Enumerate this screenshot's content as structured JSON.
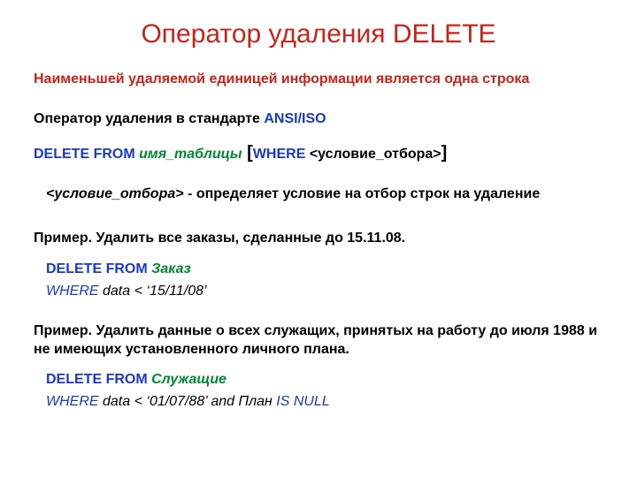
{
  "title": "Оператор удаления DELETE",
  "intro": "Наименьшей удаляемой единицей информации является одна строка",
  "std_label_prefix": "Оператор удаления в стандарте ",
  "std_label_ansi": "ANSI/ISO",
  "syntax": {
    "delete_from": "DELETE FROM  ",
    "table": "имя_таблицы",
    "open": " [",
    "where": "WHERE ",
    "cond": "<условие_отбора>",
    "close": "]"
  },
  "cond_note_cond": "<условие_отбора>",
  "cond_note_rest": " - определяет условие на отбор строк на удаление",
  "ex1_prompt": "Пример. Удалить все заказы, сделанные до 15.11.08.",
  "ex1_l1_df": "DELETE FROM ",
  "ex1_l1_tbl": "Заказ",
  "ex1_l2_where": "WHERE",
  "ex1_l2_rest": " data < ‘15/11/08’",
  "ex2_prompt": "Пример. Удалить данные о всех служащих, принятых на работу до июля 1988 и не имеющих установленного личного плана.",
  "ex2_l1_df": "DELETE FROM ",
  "ex2_l1_tbl": "Служащие",
  "ex2_l2_where": "WHERE",
  "ex2_l2_mid": " data < ‘01/07/88’ and План ",
  "ex2_l2_isnull": "IS NULL"
}
